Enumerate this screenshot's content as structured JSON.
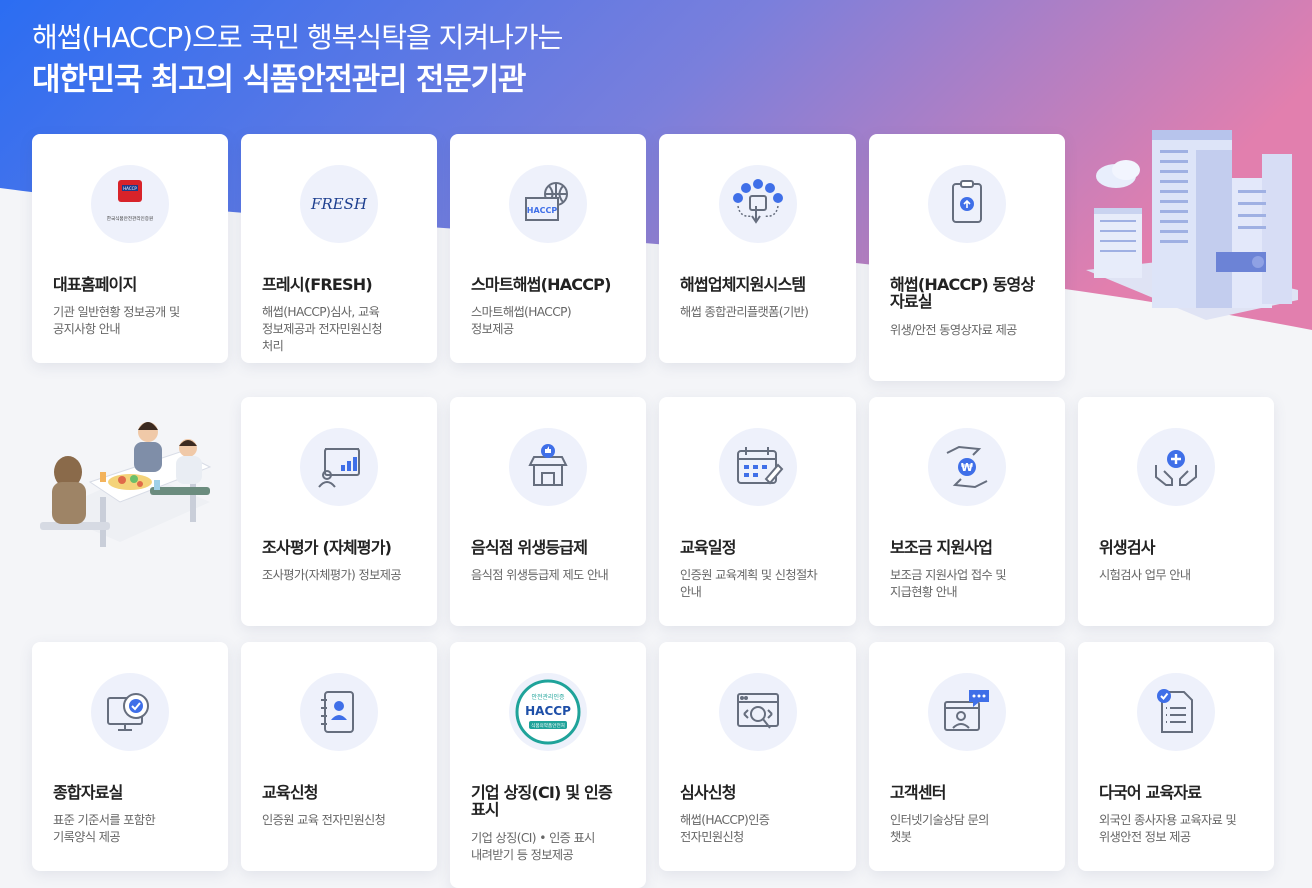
{
  "hero": {
    "line1": "해썹(HACCP)으로 국민 행복식탁을 지켜나가는",
    "line2": "대한민국 최고의 식품안전관리 전문기관"
  },
  "colors": {
    "gradient_start": "#2d6ff0",
    "gradient_end": "#e07ab0",
    "icon_blue": "#3f6fe8",
    "circle_bg": "#eef1fb"
  },
  "cards": [
    {
      "title": "대표홈페이지",
      "desc": "기관 일반현황 정보공개 및\n공지사항 안내",
      "icon": "haccp-logo-icon",
      "logo_caption": "한국식품안전관리인증원"
    },
    {
      "title": "프레시(FRESH)",
      "desc": "해썹(HACCP)심사, 교육\n정보제공과 전자민원신청\n처리",
      "icon": "fresh-logo-icon",
      "logo_text": "FRESH"
    },
    {
      "title": "스마트해썹(HACCP)",
      "desc": "스마트해썹(HACCP)\n정보제공",
      "icon": "smart-haccp-icon",
      "logo_text": "HACCP"
    },
    {
      "title": "해썹업체지원시스템",
      "desc": "해썹 종합관리플랫폼(기반)",
      "icon": "support-system-icon"
    },
    {
      "title": "해썹(HACCP) 동영상\n자료실",
      "desc": "위생/안전 동영상자료 제공",
      "icon": "video-clipboard-icon"
    },
    {
      "title": "조사평가 (자체평가)",
      "desc": "조사평가(자체평가) 정보제공",
      "icon": "presentation-chart-icon"
    },
    {
      "title": "음식점 위생등급제",
      "desc": "음식점 위생등급제 제도 안내",
      "icon": "restaurant-thumbs-up-icon"
    },
    {
      "title": "교육일정",
      "desc": "인증원 교육계획 및 신청절차\n안내",
      "icon": "calendar-icon"
    },
    {
      "title": "보조금 지원사업",
      "desc": "보조금 지원사업 접수 및\n지급현황 안내",
      "icon": "subsidy-hands-icon"
    },
    {
      "title": "위생검사",
      "desc": "시험검사 업무 안내",
      "icon": "health-check-hands-icon"
    },
    {
      "title": "종합자료실",
      "desc": "표준 기준서를 포함한\n기록양식 제공",
      "icon": "settings-monitor-icon"
    },
    {
      "title": "교육신청",
      "desc": "인증원 교육 전자민원신청",
      "icon": "contact-book-icon"
    },
    {
      "title": "기업 상징(CI) 및 인증\n표시",
      "desc": "기업 상징(CI) • 인증 표시\n내려받기 등 정보제공",
      "icon": "haccp-certification-badge-icon",
      "badge_top": "안전관리인증",
      "badge_main": "HACCP",
      "badge_bottom": "식품의약품안전처"
    },
    {
      "title": "심사신청",
      "desc": "해썹(HACCP)인증\n전자민원신청",
      "icon": "inspection-magnifier-icon"
    },
    {
      "title": "고객센터",
      "desc": "인터넷기술상담 문의\n챗봇",
      "icon": "customer-chat-icon"
    },
    {
      "title": "다국어 교육자료",
      "desc": "외국인 종사자용 교육자료 및\n위생안전 정보 제공",
      "icon": "checklist-document-icon"
    }
  ]
}
